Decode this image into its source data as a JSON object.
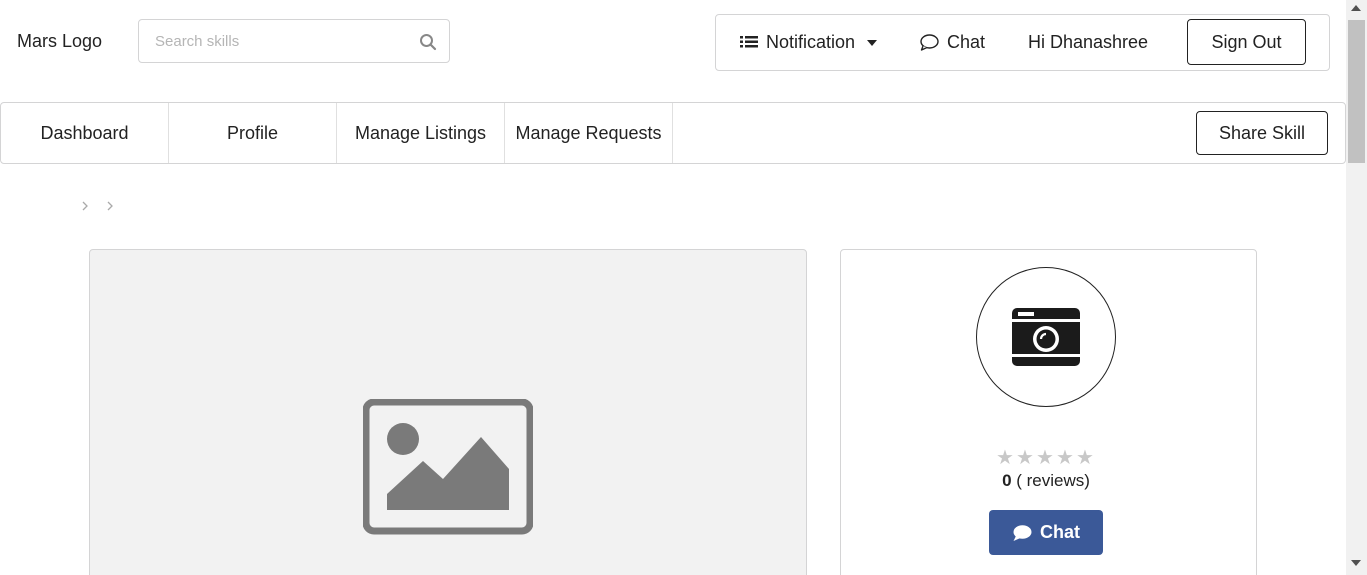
{
  "header": {
    "logo": "Mars Logo",
    "search": {
      "placeholder": "Search skills",
      "value": ""
    },
    "notification_label": "Notification",
    "chat_label": "Chat",
    "greeting": "Hi Dhanashree",
    "signout_label": "Sign Out"
  },
  "nav": {
    "items": [
      {
        "label": "Dashboard"
      },
      {
        "label": "Profile"
      },
      {
        "label": "Manage Listings"
      },
      {
        "label": "Manage Requests"
      }
    ],
    "share_label": "Share Skill"
  },
  "breadcrumb": {
    "separators": [
      "chevron-right-icon",
      "chevron-right-icon"
    ]
  },
  "listing_image": {
    "icon": "image-placeholder-icon"
  },
  "profile_card": {
    "avatar_icon": "camera-icon",
    "rating": {
      "value": 0,
      "max": 5
    },
    "review_count": "0",
    "review_suffix": "( reviews)",
    "chat_label": "Chat"
  },
  "colors": {
    "chat_button": "#3b5998",
    "star_empty": "#c8c8c8",
    "image_placeholder_bg": "#f2f2f2",
    "border": "#d4d4d5"
  }
}
